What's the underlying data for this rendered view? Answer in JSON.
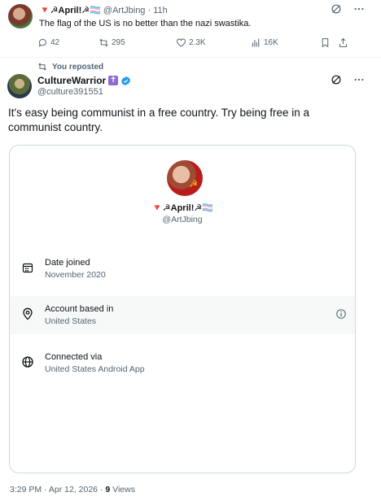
{
  "parent_tweet": {
    "display_name": "🔻☭April!☭🏳️‍⚧️",
    "handle": "@ArtJbing",
    "time": "11h",
    "separator": "·",
    "text": "The flag of the US is no better than the nazi swastika.",
    "replies": "42",
    "reposts": "295",
    "likes": "2.3K",
    "views": "16K"
  },
  "repost_indicator": "You reposted",
  "main_tweet": {
    "display_name": "CultureWarrior",
    "badge_glyph": "✝",
    "handle": "@culture391551",
    "text": "It's easy being communist in a free country. Try being free in a communist country."
  },
  "card": {
    "display_name": "🔻☭April!☭🏳️‍⚧️",
    "handle": "@ArtJbing",
    "rows": [
      {
        "label": "Date joined",
        "value": "November 2020",
        "icon": "calendar-icon"
      },
      {
        "label": "Account based in",
        "value": "United States",
        "icon": "location-pin-icon"
      },
      {
        "label": "Connected via",
        "value": "United States Android App",
        "icon": "globe-icon"
      }
    ]
  },
  "footer": {
    "time": "3:29 PM",
    "separator": "·",
    "date": "Apr 12, 2026",
    "views_count": "9",
    "views_label": "Views"
  },
  "colors": {
    "text_primary": "#0f1419",
    "text_secondary": "#536471",
    "border": "#cfd9de",
    "verified_blue": "#1d9bf0",
    "row_highlight": "#f7f9f9"
  }
}
